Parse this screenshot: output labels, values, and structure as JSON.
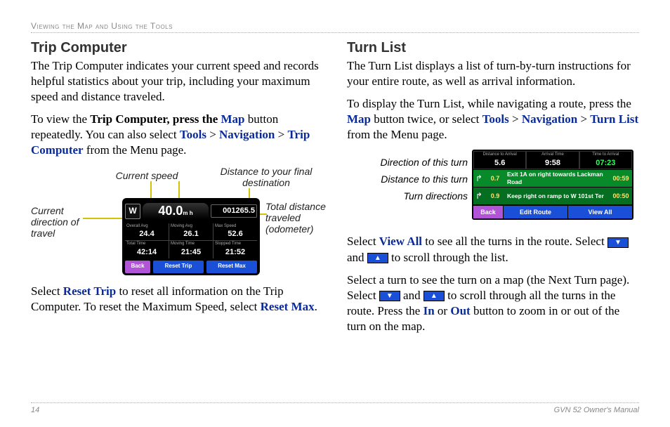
{
  "header": "Viewing the Map and Using the Tools",
  "left": {
    "title": "Trip Computer",
    "p1": "The Trip Computer indicates your current speed and records helpful statistics about your trip, including your maximum speed and distance traveled.",
    "p2a": "To view the ",
    "p2b": "Trip Computer, press the ",
    "p2_map": "Map",
    "p2c": " button repeatedly. You can also select ",
    "p2_tools": "Tools",
    "p2_gt": " > ",
    "p2_nav": "Navigation",
    "p2_tc": "Trip Computer",
    "p2d": " from the Menu page.",
    "labels": {
      "cspeed": "Current speed",
      "dist": "Distance to your final destination",
      "dir": "Current direction of travel",
      "odo": "Total distance traveled (odometer)"
    },
    "device": {
      "dir": "W",
      "speed": "40.0",
      "speed_unit": "m h",
      "dest": "001265.5",
      "cells": [
        {
          "lbl": "Overall Avg",
          "val": "24.4"
        },
        {
          "lbl": "Moving Avg",
          "val": "26.1"
        },
        {
          "lbl": "Max Speed",
          "val": "52.6"
        },
        {
          "lbl": "Total Time",
          "val": "42:14"
        },
        {
          "lbl": "Moving Time",
          "val": "21:45"
        },
        {
          "lbl": "Stopped Time",
          "val": "21:52"
        }
      ],
      "btns": {
        "back": "Back",
        "rt": "Reset Trip",
        "rm": "Reset Max"
      }
    },
    "p3a": "Select ",
    "p3_rt": "Reset Trip",
    "p3b": " to reset all information on the Trip Computer. To reset the Maximum Speed, select ",
    "p3_rm": "Reset Max",
    "p3c": "."
  },
  "right": {
    "title": "Turn List",
    "p1": "The Turn List displays a list of turn-by-turn instructions for your entire route, as well as arrival information.",
    "p2a": "To display the Turn List, while navigating a route, press the ",
    "p2_map": "Map",
    "p2b": " button twice, or select ",
    "p2_tools": "Tools",
    "p2_gt": " > ",
    "p2_nav": "Navigation",
    "p2_tl": "Turn List",
    "p2c": " from the Menu page.",
    "labels": {
      "dir": "Direction of this turn",
      "dist": "Distance to this turn",
      "turns": "Turn directions"
    },
    "device": {
      "hdr": [
        {
          "lbl": "Distance to Arrival",
          "val": "5.6"
        },
        {
          "lbl": "Arrival Time",
          "val": "9:58"
        },
        {
          "lbl": "Time to Arrival",
          "val": "07:23",
          "green": true
        }
      ],
      "rows": [
        {
          "dist": "0.7",
          "txt": "Exit 1A on right towards Lackman Road",
          "eta": "00:59"
        },
        {
          "dist": "0.9",
          "txt": "Keep right on ramp to W 101st Ter",
          "eta": "00:50"
        }
      ],
      "btns": {
        "back": "Back",
        "edit": "Edit Route",
        "va": "View All"
      }
    },
    "p3a": "Select ",
    "p3_va": "View All",
    "p3b": " to see all the turns in the route. Select ",
    "p3c": " and ",
    "p3d": " to scroll through the list.",
    "p4a": "Select a turn to see the turn on a map (the Next Turn page). Select ",
    "p4b": " and ",
    "p4c": " to scroll through all the turns in the route. Press the ",
    "p4_in": "In",
    "p4d": " or ",
    "p4_out": "Out",
    "p4e": " button to zoom in or out of the turn on the map."
  },
  "footer": {
    "page": "14",
    "book": "GVN 52 Owner's Manual"
  }
}
